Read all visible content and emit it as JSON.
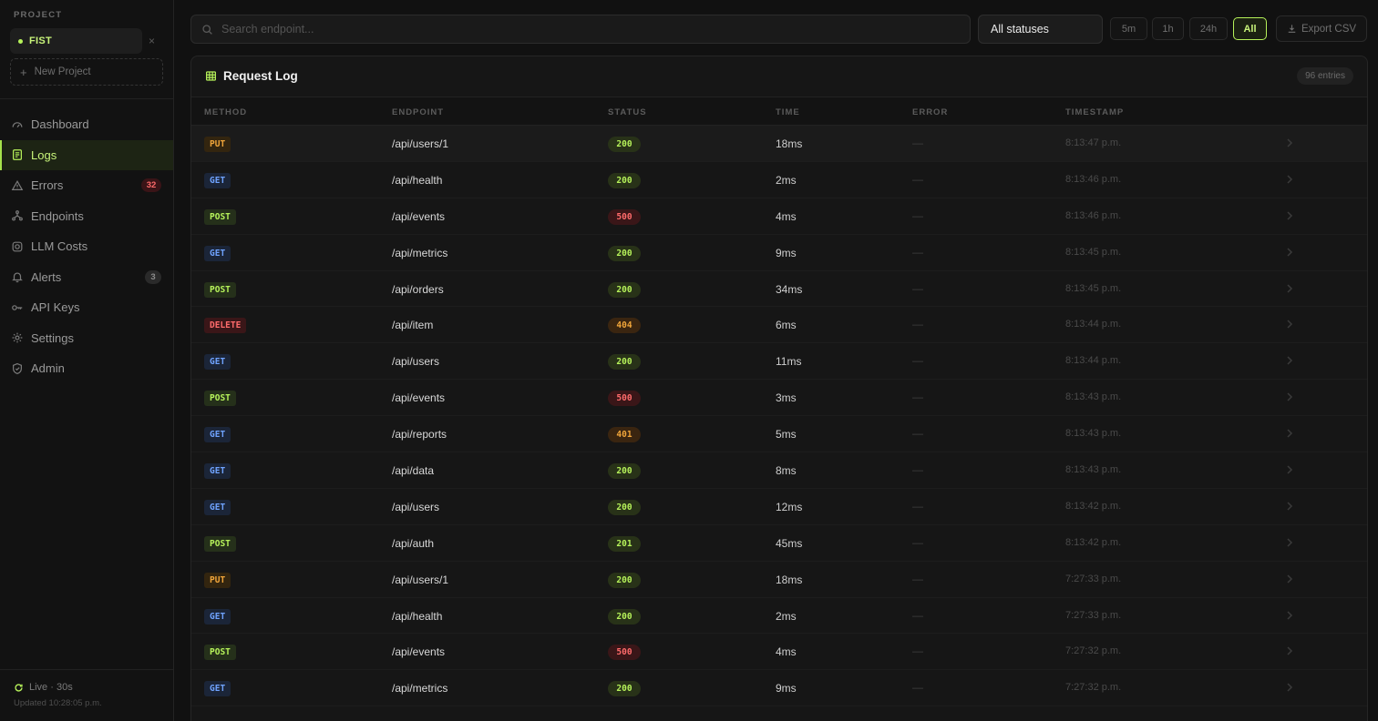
{
  "sidebar": {
    "project_label": "PROJECT",
    "project_name": "FIST",
    "close_glyph": "×",
    "new_project_label": "New Project",
    "nav": [
      {
        "label": "Dashboard",
        "icon": "gauge-icon"
      },
      {
        "label": "Logs",
        "icon": "log-icon",
        "active": true
      },
      {
        "label": "Errors",
        "icon": "warning-icon",
        "badge": "32"
      },
      {
        "label": "Endpoints",
        "icon": "endpoints-icon"
      },
      {
        "label": "LLM Costs",
        "icon": "coin-icon"
      },
      {
        "label": "Alerts",
        "icon": "bell-icon",
        "badge": "3"
      },
      {
        "label": "API Keys",
        "icon": "key-icon"
      },
      {
        "label": "Settings",
        "icon": "gear-icon"
      },
      {
        "label": "Admin",
        "icon": "shield-icon"
      }
    ],
    "live_label": "Live · 30s",
    "updated_label": "Updated 10:28:05 p.m."
  },
  "toolbar": {
    "search_placeholder": "Search endpoint...",
    "status_filter": "All statuses",
    "ranges": [
      "5m",
      "1h",
      "24h",
      "All"
    ],
    "active_range": "All",
    "export_label": "Export CSV"
  },
  "panel": {
    "title": "Request Log",
    "entries": "96 entries",
    "columns": [
      "METHOD",
      "ENDPOINT",
      "STATUS",
      "TIME",
      "ERROR",
      "TIMESTAMP"
    ]
  },
  "rows": [
    {
      "method": "PUT",
      "endpoint": "/api/users/1",
      "status": "200",
      "time": "18ms",
      "error": "—",
      "timestamp": "8:13:47 p.m."
    },
    {
      "method": "GET",
      "endpoint": "/api/health",
      "status": "200",
      "time": "2ms",
      "error": "—",
      "timestamp": "8:13:46 p.m."
    },
    {
      "method": "POST",
      "endpoint": "/api/events",
      "status": "500",
      "time": "4ms",
      "error": "—",
      "timestamp": "8:13:46 p.m."
    },
    {
      "method": "GET",
      "endpoint": "/api/metrics",
      "status": "200",
      "time": "9ms",
      "error": "—",
      "timestamp": "8:13:45 p.m."
    },
    {
      "method": "POST",
      "endpoint": "/api/orders",
      "status": "200",
      "time": "34ms",
      "error": "—",
      "timestamp": "8:13:45 p.m."
    },
    {
      "method": "DELETE",
      "endpoint": "/api/item",
      "status": "404",
      "time": "6ms",
      "error": "—",
      "timestamp": "8:13:44 p.m."
    },
    {
      "method": "GET",
      "endpoint": "/api/users",
      "status": "200",
      "time": "11ms",
      "error": "—",
      "timestamp": "8:13:44 p.m."
    },
    {
      "method": "POST",
      "endpoint": "/api/events",
      "status": "500",
      "time": "3ms",
      "error": "—",
      "timestamp": "8:13:43 p.m."
    },
    {
      "method": "GET",
      "endpoint": "/api/reports",
      "status": "401",
      "time": "5ms",
      "error": "—",
      "timestamp": "8:13:43 p.m."
    },
    {
      "method": "GET",
      "endpoint": "/api/data",
      "status": "200",
      "time": "8ms",
      "error": "—",
      "timestamp": "8:13:43 p.m."
    },
    {
      "method": "GET",
      "endpoint": "/api/users",
      "status": "200",
      "time": "12ms",
      "error": "—",
      "timestamp": "8:13:42 p.m."
    },
    {
      "method": "POST",
      "endpoint": "/api/auth",
      "status": "201",
      "time": "45ms",
      "error": "—",
      "timestamp": "8:13:42 p.m."
    },
    {
      "method": "PUT",
      "endpoint": "/api/users/1",
      "status": "200",
      "time": "18ms",
      "error": "—",
      "timestamp": "7:27:33 p.m."
    },
    {
      "method": "GET",
      "endpoint": "/api/health",
      "status": "200",
      "time": "2ms",
      "error": "—",
      "timestamp": "7:27:33 p.m."
    },
    {
      "method": "POST",
      "endpoint": "/api/events",
      "status": "500",
      "time": "4ms",
      "error": "—",
      "timestamp": "7:27:32 p.m."
    },
    {
      "method": "GET",
      "endpoint": "/api/metrics",
      "status": "200",
      "time": "9ms",
      "error": "—",
      "timestamp": "7:27:32 p.m."
    }
  ],
  "colors": {
    "accent": "#b6f25a",
    "background": "#111111",
    "get": "#6fa3ff",
    "error": "#ff6b6b",
    "warn": "#f0a53a"
  }
}
